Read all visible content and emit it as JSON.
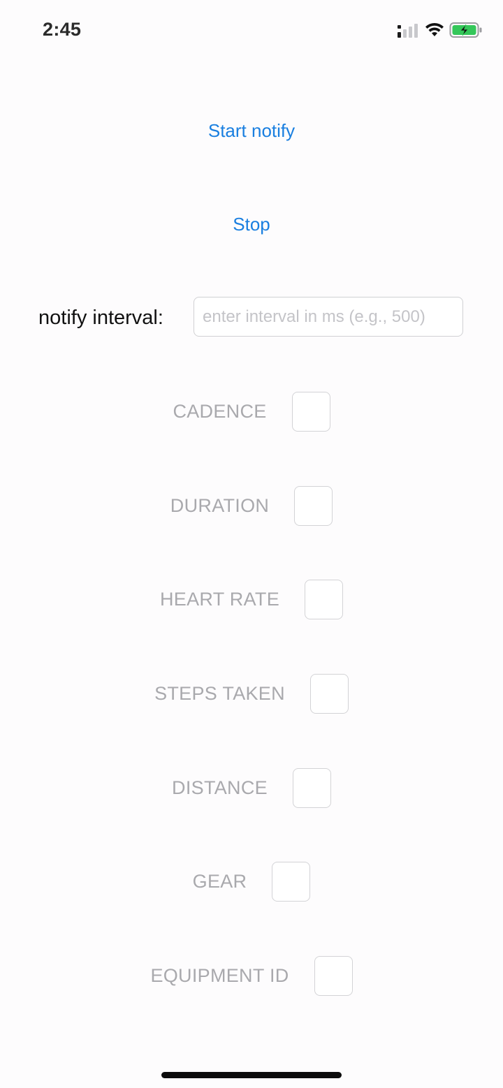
{
  "status_bar": {
    "time": "2:45",
    "icons": [
      "signal-icon",
      "wifi-icon",
      "battery-charging-icon"
    ],
    "battery_color": "#34c759"
  },
  "actions": {
    "start_label": "Start notify",
    "stop_label": "Stop",
    "accent_color": "#1a7fe0"
  },
  "interval": {
    "label": "notify interval:",
    "value": "",
    "placeholder": "enter interval in ms (e.g., 500)"
  },
  "metrics": [
    {
      "label": "CADENCE",
      "checked": false
    },
    {
      "label": "DURATION",
      "checked": false
    },
    {
      "label": "HEART RATE",
      "checked": false
    },
    {
      "label": "STEPS TAKEN",
      "checked": false
    },
    {
      "label": "DISTANCE",
      "checked": false
    },
    {
      "label": "GEAR",
      "checked": false
    },
    {
      "label": "EQUIPMENT ID",
      "checked": false
    }
  ]
}
